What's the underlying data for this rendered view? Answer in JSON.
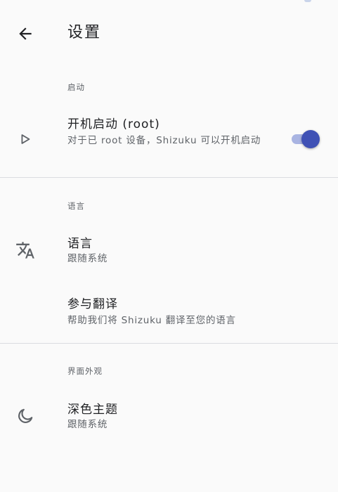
{
  "appbar": {
    "title": "设置",
    "back_icon": "arrow-back-icon"
  },
  "sections": {
    "startup": {
      "header": "启动",
      "item": {
        "title": "开机启动 (root)",
        "summary": "对于已 root 设备，Shizuku 可以开机启动",
        "icon": "play-icon",
        "toggle_on": true
      }
    },
    "language": {
      "header": "语言",
      "language_item": {
        "title": "语言",
        "summary": "跟随系统",
        "icon": "translate-icon"
      },
      "translate_item": {
        "title": "参与翻译",
        "summary": "帮助我们将 Shizuku 翻译至您的语言"
      }
    },
    "appearance": {
      "header": "界面外观",
      "dark_theme_item": {
        "title": "深色主题",
        "summary": "跟随系统",
        "icon": "moon-icon"
      }
    }
  },
  "colors": {
    "accent": "#3f51b5",
    "accent_track": "#a9b4e2",
    "background": "#fafafa",
    "divider": "#dadce0"
  }
}
